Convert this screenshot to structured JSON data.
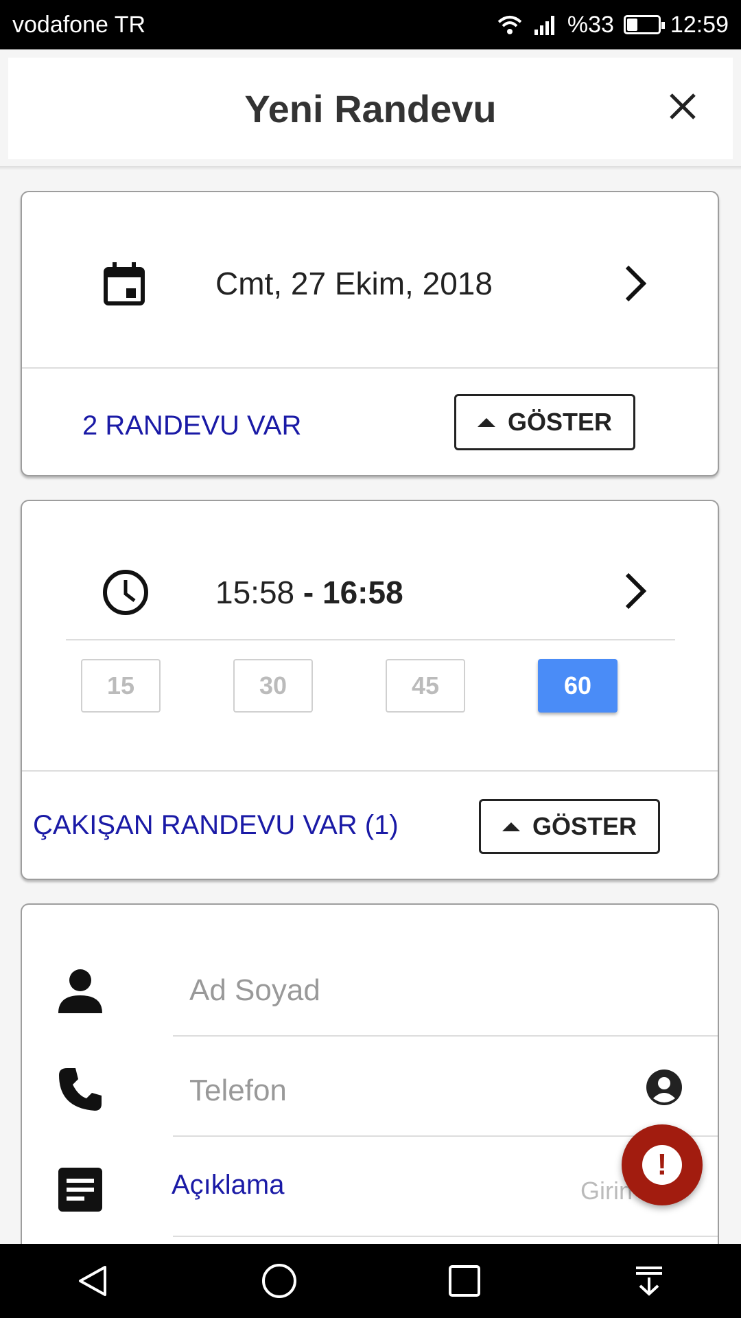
{
  "status_bar": {
    "carrier": "vodafone TR",
    "battery_text": "%33",
    "battery_level": 0.33,
    "time": "12:59",
    "icons": [
      "wifi-icon",
      "signal-icon",
      "battery-icon"
    ]
  },
  "header": {
    "title": "Yeni Randevu",
    "close_icon": "close-icon"
  },
  "date_card": {
    "date": "Cmt, 27 Ekim, 2018",
    "appointments_text": "2 RANDEVU VAR",
    "show_button": "GÖSTER",
    "icons": [
      "calendar-icon",
      "chevron-right-icon",
      "arrow-up-icon"
    ]
  },
  "time_card": {
    "start_time": "15:58",
    "separator": " - ",
    "end_time": "16:58",
    "durations": [
      "15",
      "30",
      "45",
      "60"
    ],
    "selected_duration": "60",
    "conflict_text": "ÇAKIŞAN RANDEVU VAR (1)",
    "show_button": "GÖSTER",
    "icons": [
      "clock-icon",
      "chevron-right-icon",
      "arrow-up-icon"
    ]
  },
  "form": {
    "name_placeholder": "Ad Soyad",
    "phone_placeholder": "Telefon",
    "description_label": "Açıklama",
    "description_hint": "Girin",
    "icons": [
      "person-icon",
      "phone-icon",
      "contact-picker-icon",
      "notes-icon"
    ]
  },
  "fab": {
    "icon": "alert-icon",
    "label": "!"
  },
  "nav": {
    "icons": [
      "back-icon",
      "home-icon",
      "recents-icon",
      "notification-pull-icon"
    ]
  },
  "colors": {
    "accent_blue": "#4a8cf7",
    "link_blue": "#1a1aa6",
    "fab_red": "#a21c0f"
  }
}
